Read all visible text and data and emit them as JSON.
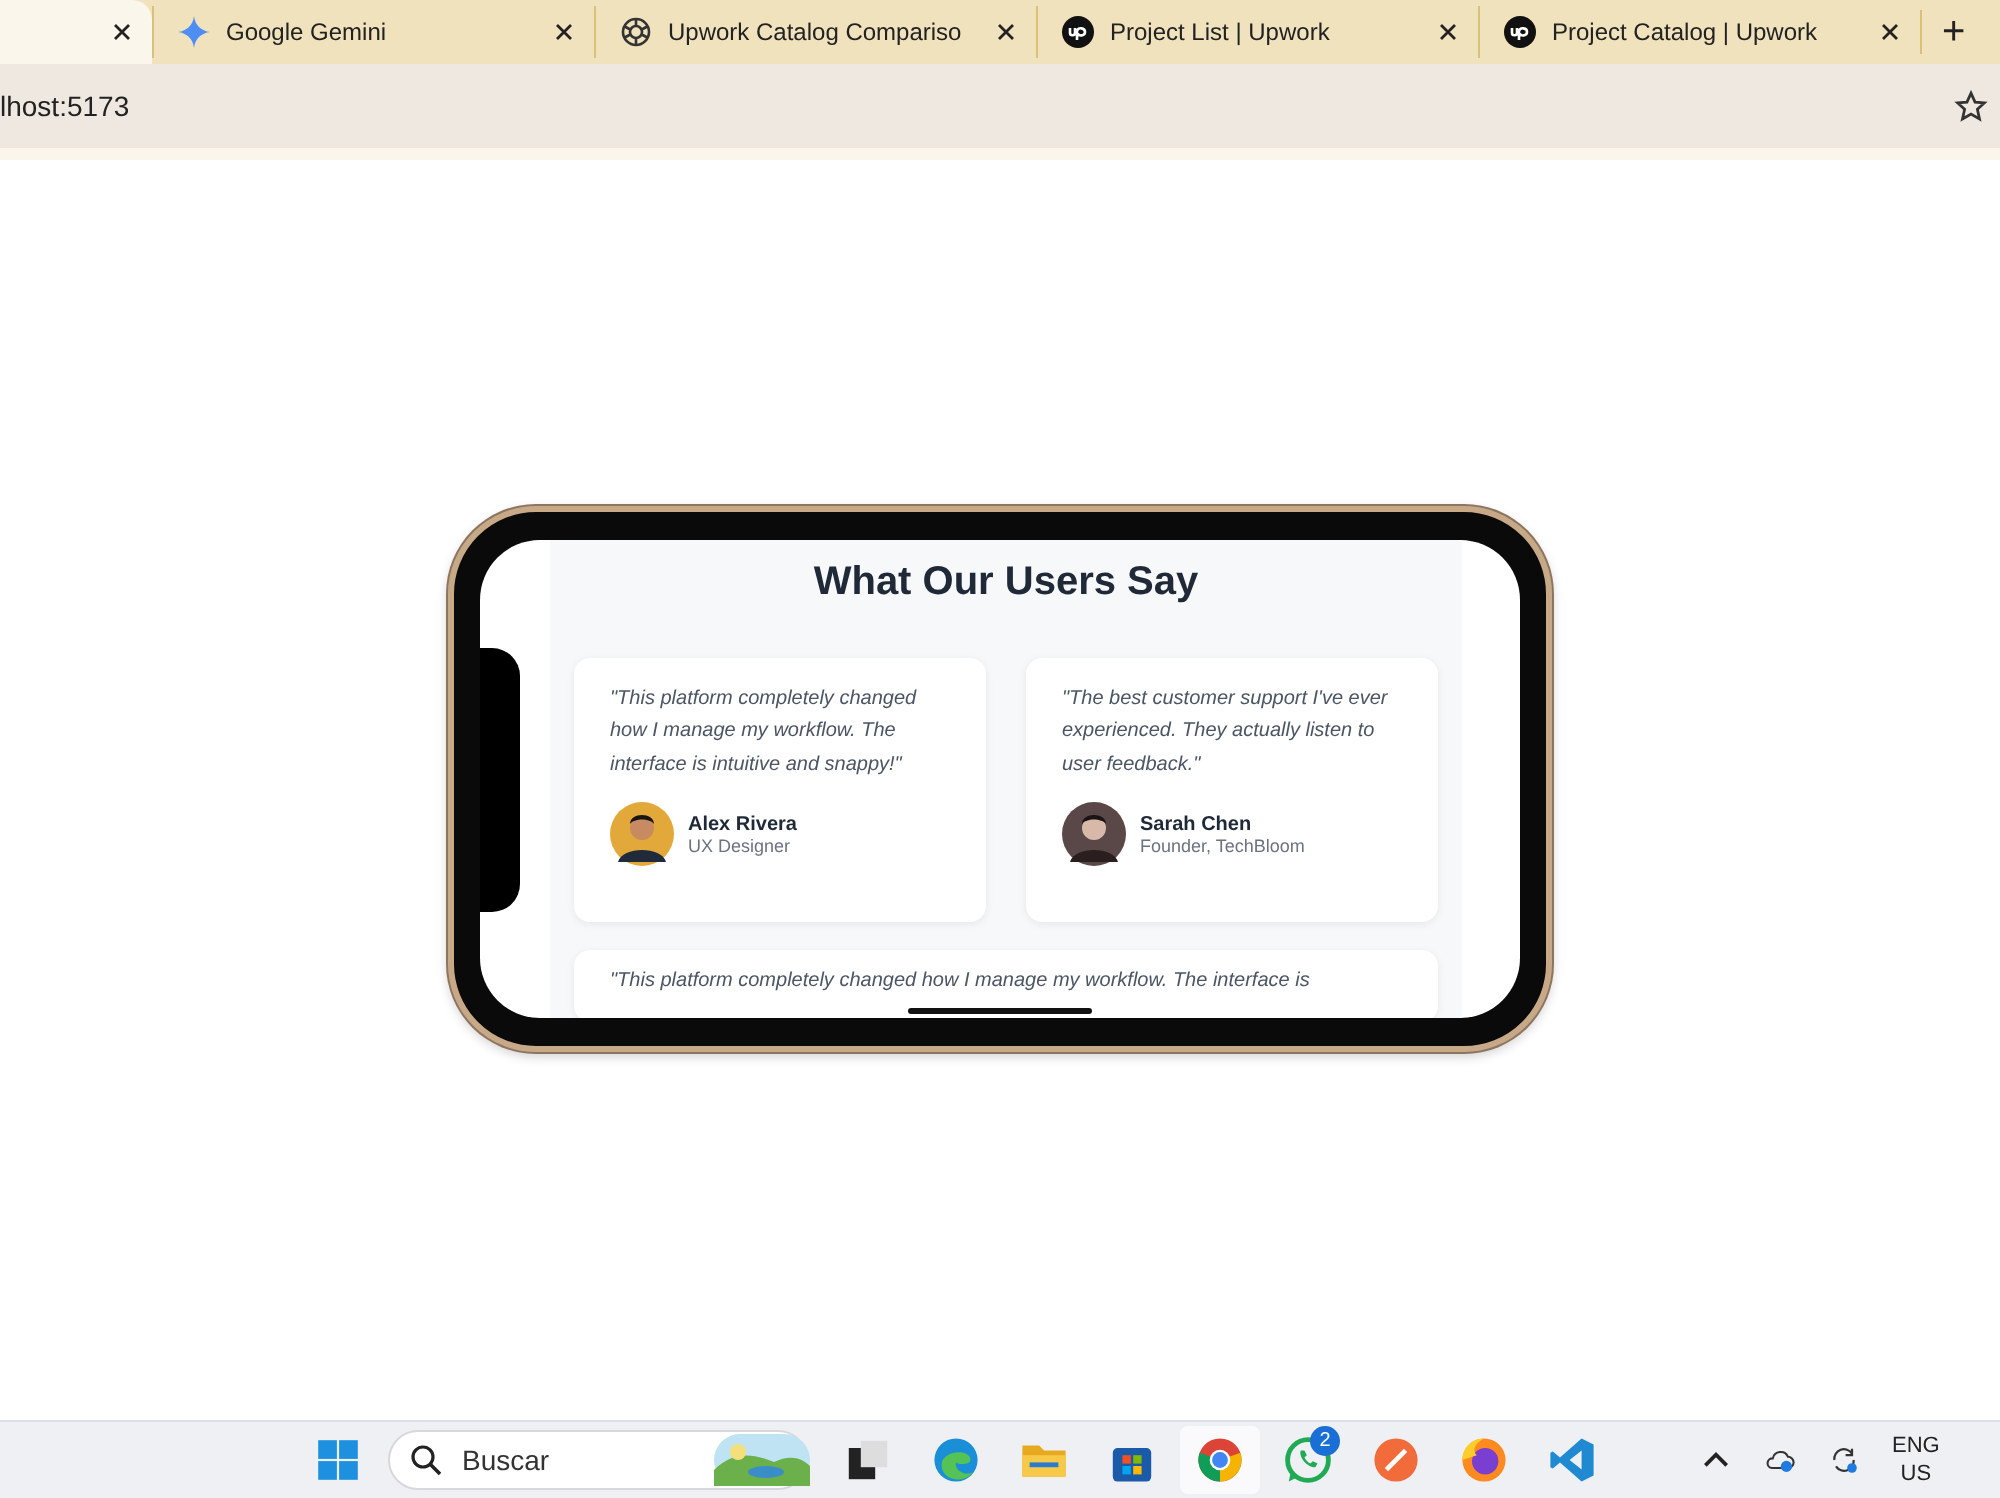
{
  "browser": {
    "tabs": [
      {
        "kind": "blank",
        "selected": true
      },
      {
        "kind": "gemini",
        "title": "Google Gemini",
        "selected": false
      },
      {
        "kind": "openai",
        "title": "Upwork Catalog Compariso",
        "selected": false
      },
      {
        "kind": "upwork",
        "title": "Project List | Upwork",
        "selected": false
      },
      {
        "kind": "upwork",
        "title": "Project Catalog | Upwork",
        "selected": false
      }
    ],
    "new_tab": "+",
    "address": "lhost:5173"
  },
  "page": {
    "title": "What Our Users Say",
    "testimonials": [
      {
        "quote": "\"This platform completely changed how I manage my workflow. The interface is intuitive and snappy!\"",
        "name": "Alex Rivera",
        "role": "UX Designer"
      },
      {
        "quote": "\"The best customer support I've ever experienced. They actually listen to user feedback.\"",
        "name": "Sarah Chen",
        "role": "Founder, TechBloom"
      },
      {
        "quote": "\"This platform completely changed how I manage my workflow. The interface is"
      }
    ]
  },
  "taskbar": {
    "search": {
      "placeholder": "Buscar"
    },
    "apps": [
      {
        "kind": "widgets",
        "selected": false
      },
      {
        "kind": "taskview",
        "selected": false
      },
      {
        "kind": "edge",
        "selected": false
      },
      {
        "kind": "files",
        "selected": false
      },
      {
        "kind": "store",
        "selected": false
      },
      {
        "kind": "chrome",
        "selected": true
      },
      {
        "kind": "whatsapp",
        "selected": false,
        "badge": "2"
      },
      {
        "kind": "orange",
        "selected": false
      },
      {
        "kind": "firefox",
        "selected": false
      },
      {
        "kind": "vscode",
        "selected": false
      }
    ],
    "language": [
      "ENG",
      "US"
    ]
  }
}
